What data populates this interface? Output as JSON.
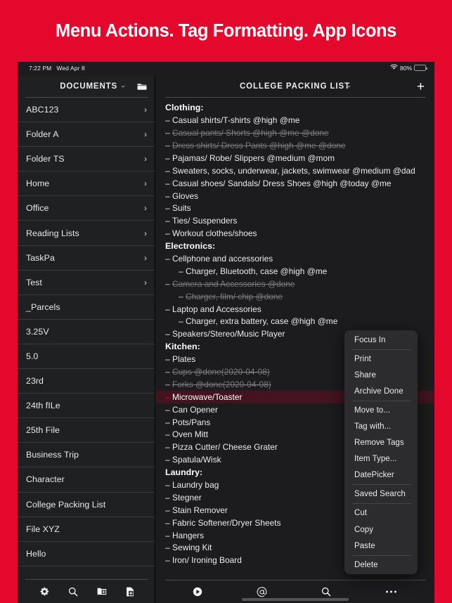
{
  "banner": {
    "title": "Menu Actions. Tag Formatting. App Icons"
  },
  "status_bar": {
    "time": "7:22 PM",
    "date": "Wed Apr 8",
    "wifi_icon": "wifi-icon",
    "battery_percent": "80%",
    "battery_icon": "battery-icon"
  },
  "sidebar": {
    "header": {
      "title": "DOCUMENTS",
      "caret_icon": "chevron-down-icon",
      "folder_icon": "folder-icon"
    },
    "items": [
      {
        "label": "ABC123",
        "chevron": "›",
        "has_chevron": true
      },
      {
        "label": "Folder A",
        "chevron": "›",
        "has_chevron": true
      },
      {
        "label": "Folder TS",
        "chevron": "›",
        "has_chevron": true
      },
      {
        "label": "Home",
        "chevron": "›",
        "has_chevron": true
      },
      {
        "label": "Office",
        "chevron": "›",
        "has_chevron": true
      },
      {
        "label": "Reading Lists",
        "chevron": "›",
        "has_chevron": true
      },
      {
        "label": "TaskPa",
        "chevron": "›",
        "has_chevron": true
      },
      {
        "label": "Test",
        "chevron": "›",
        "has_chevron": true
      },
      {
        "label": "_Parcels",
        "chevron": "",
        "has_chevron": false
      },
      {
        "label": "3.25V",
        "chevron": "",
        "has_chevron": false
      },
      {
        "label": "5.0",
        "chevron": "",
        "has_chevron": false
      },
      {
        "label": "23rd",
        "chevron": "",
        "has_chevron": false
      },
      {
        "label": "24th fILe",
        "chevron": "",
        "has_chevron": false
      },
      {
        "label": "25th File",
        "chevron": "",
        "has_chevron": false
      },
      {
        "label": "Business Trip",
        "chevron": "",
        "has_chevron": false
      },
      {
        "label": "Character",
        "chevron": "",
        "has_chevron": false
      },
      {
        "label": "College Packing List",
        "chevron": "",
        "has_chevron": false
      },
      {
        "label": "File XYZ",
        "chevron": "",
        "has_chevron": false
      },
      {
        "label": "Hello",
        "chevron": "",
        "has_chevron": false
      }
    ],
    "footer_icons": [
      "gear-icon",
      "search-icon",
      "new-folder-icon",
      "new-document-icon"
    ]
  },
  "main": {
    "header": {
      "title": "COLLEGE PACKING LIST",
      "caret_icon": "chevron-down-icon",
      "add_icon": "plus-icon",
      "add_label": "+"
    },
    "outline": [
      {
        "text": "Clothing:",
        "type": "header",
        "indent": 0,
        "done": false,
        "selected": false
      },
      {
        "text": "Casual shirts/T-shirts @high @me",
        "type": "item",
        "indent": 0,
        "done": false,
        "selected": false
      },
      {
        "text": "Casual pants/ Shorts @high @me @done",
        "type": "item",
        "indent": 0,
        "done": true,
        "selected": false
      },
      {
        "text": "Dress shirts/ Dress Pants @high @me @done",
        "type": "item",
        "indent": 0,
        "done": true,
        "selected": false
      },
      {
        "text": "Pajamas/ Robe/ Slippers @medium @mom",
        "type": "item",
        "indent": 0,
        "done": false,
        "selected": false
      },
      {
        "text": "Sweaters, socks, underwear, jackets, swimwear @medium @dad",
        "type": "item",
        "indent": 0,
        "done": false,
        "selected": false
      },
      {
        "text": "Casual shoes/ Sandals/ Dress Shoes @high @today @me",
        "type": "item",
        "indent": 0,
        "done": false,
        "selected": false
      },
      {
        "text": "Gloves",
        "type": "item",
        "indent": 0,
        "done": false,
        "selected": false
      },
      {
        "text": "Suits",
        "type": "item",
        "indent": 0,
        "done": false,
        "selected": false
      },
      {
        "text": "Ties/ Suspenders",
        "type": "item",
        "indent": 0,
        "done": false,
        "selected": false
      },
      {
        "text": "Workout clothes/shoes",
        "type": "item",
        "indent": 0,
        "done": false,
        "selected": false
      },
      {
        "text": "Electronics:",
        "type": "header",
        "indent": 0,
        "done": false,
        "selected": false
      },
      {
        "text": "Cellphone and accessories",
        "type": "item",
        "indent": 0,
        "done": false,
        "selected": false
      },
      {
        "text": "Charger, Bluetooth, case @high @me",
        "type": "item",
        "indent": 1,
        "done": false,
        "selected": false
      },
      {
        "text": "Camera and Accessories @done",
        "type": "item",
        "indent": 0,
        "done": true,
        "selected": false
      },
      {
        "text": "Charger, film/ chip @done",
        "type": "item",
        "indent": 1,
        "done": true,
        "selected": false
      },
      {
        "text": "Laptop and Accessories",
        "type": "item",
        "indent": 0,
        "done": false,
        "selected": false
      },
      {
        "text": "Charger, extra battery, case @high @me",
        "type": "item",
        "indent": 1,
        "done": false,
        "selected": false
      },
      {
        "text": "Speakers/Stereo/Music Player",
        "type": "item",
        "indent": 0,
        "done": false,
        "selected": false
      },
      {
        "text": "Kitchen:",
        "type": "header",
        "indent": 0,
        "done": false,
        "selected": false
      },
      {
        "text": "Plates",
        "type": "item",
        "indent": 0,
        "done": false,
        "selected": false
      },
      {
        "text": "Cups @done(2020-04-08)",
        "type": "item",
        "indent": 0,
        "done": true,
        "selected": false
      },
      {
        "text": "Forks @done(2020-04-08)",
        "type": "item",
        "indent": 0,
        "done": true,
        "selected": false
      },
      {
        "text": "Microwave/Toaster",
        "type": "item",
        "indent": 0,
        "done": false,
        "selected": true
      },
      {
        "text": "Can Opener",
        "type": "item",
        "indent": 0,
        "done": false,
        "selected": false
      },
      {
        "text": "Pots/Pans",
        "type": "item",
        "indent": 0,
        "done": false,
        "selected": false
      },
      {
        "text": "Oven Mitt",
        "type": "item",
        "indent": 0,
        "done": false,
        "selected": false
      },
      {
        "text": "Pizza Cutter/ Cheese Grater",
        "type": "item",
        "indent": 0,
        "done": false,
        "selected": false
      },
      {
        "text": "Spatula/Wisk",
        "type": "item",
        "indent": 0,
        "done": false,
        "selected": false
      },
      {
        "text": "Laundry:",
        "type": "header",
        "indent": 0,
        "done": false,
        "selected": false
      },
      {
        "text": "Laundry bag",
        "type": "item",
        "indent": 0,
        "done": false,
        "selected": false
      },
      {
        "text": "Stegner",
        "type": "item",
        "indent": 0,
        "done": false,
        "selected": false
      },
      {
        "text": "Stain Remover",
        "type": "item",
        "indent": 0,
        "done": false,
        "selected": false
      },
      {
        "text": "Fabric Softener/Dryer Sheets",
        "type": "item",
        "indent": 0,
        "done": false,
        "selected": false
      },
      {
        "text": "Hangers",
        "type": "item",
        "indent": 0,
        "done": false,
        "selected": false
      },
      {
        "text": "Sewing Kit",
        "type": "item",
        "indent": 0,
        "done": false,
        "selected": false
      },
      {
        "text": "Iron/ Ironing Board",
        "type": "item",
        "indent": 0,
        "done": false,
        "selected": false
      }
    ],
    "bullet": "–",
    "footer_icons": [
      "play-icon",
      "at-sign-icon",
      "search-icon",
      "more-ellipsis-icon"
    ]
  },
  "context_menu": {
    "groups": [
      [
        "Focus In"
      ],
      [
        "Print",
        "Share",
        "Archive Done"
      ],
      [
        "Move to...",
        "Tag with...",
        "Remove Tags",
        "Item Type...",
        "DatePicker"
      ],
      [
        "Saved Search"
      ],
      [
        "Cut",
        "Copy",
        "Paste"
      ],
      [
        "Delete"
      ]
    ]
  },
  "colors": {
    "accent_red": "#e4092c",
    "selection_bg": "#431420",
    "panel_bg": "#1c1c1e",
    "sidebar_bg": "#1f2022",
    "menu_bg": "#2c2c2e",
    "battery_green": "#30d158"
  }
}
